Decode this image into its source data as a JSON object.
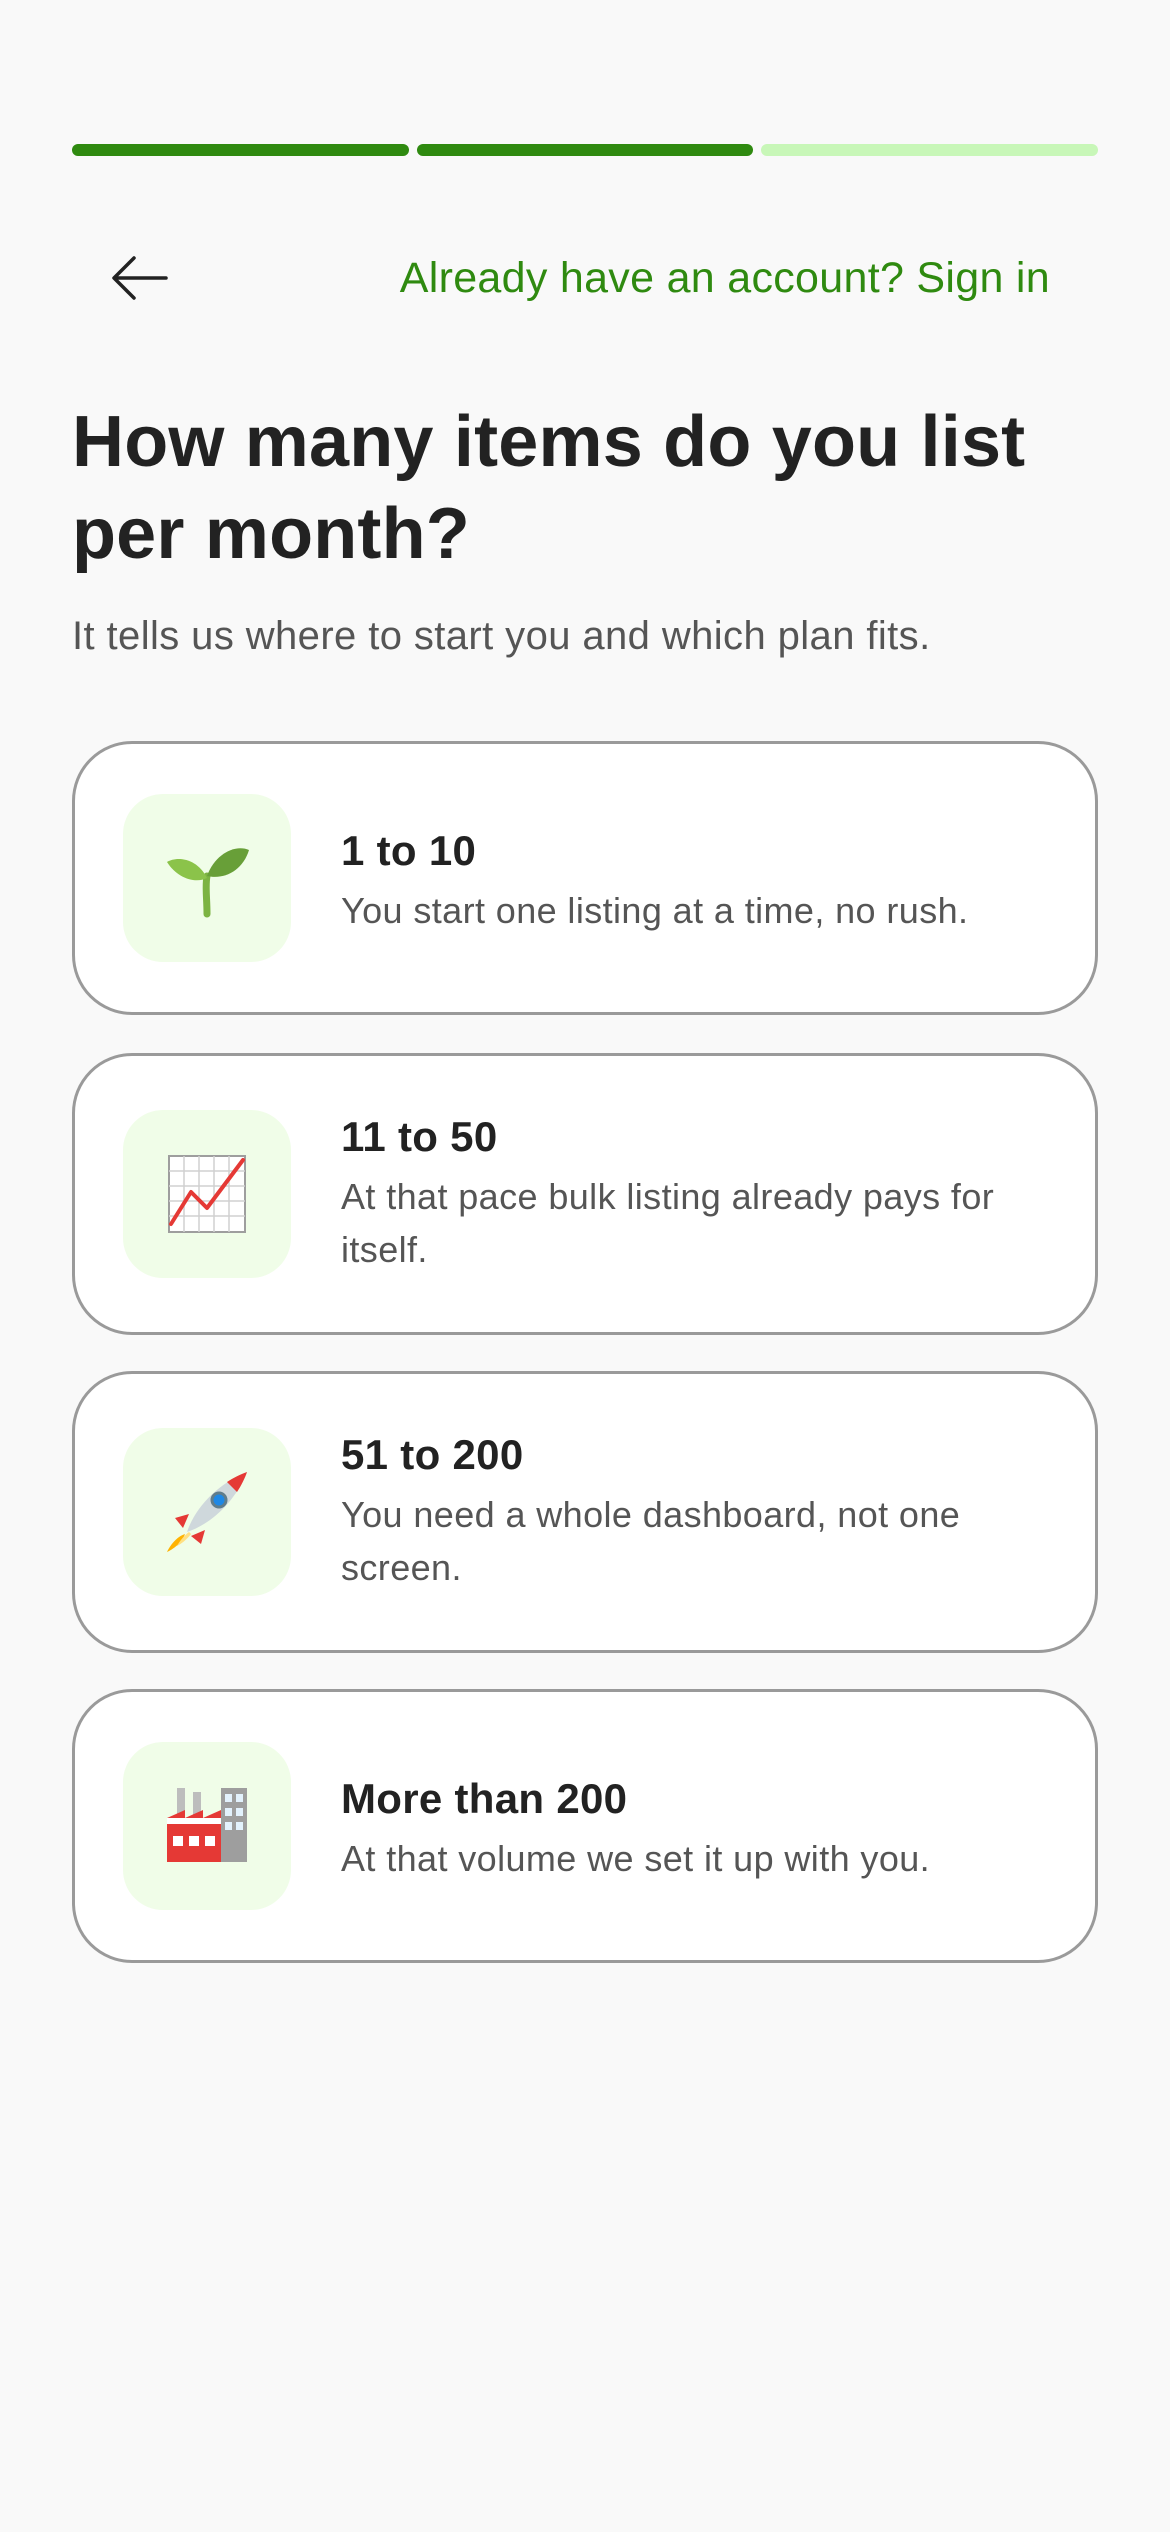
{
  "progress": {
    "steps_total": 3,
    "steps_completed": 2,
    "active_color": "#2f8a10",
    "inactive_color": "#c8f7b8"
  },
  "header": {
    "back_icon": "arrow-left-icon",
    "signin_link": "Already have an account? Sign in"
  },
  "main": {
    "title": "How many items do you list per month?",
    "subtitle": "It tells us where to start you and which plan fits."
  },
  "options": [
    {
      "icon": "seedling-icon",
      "title": "1 to 10",
      "description": "You start one listing at a time, no rush."
    },
    {
      "icon": "chart-increasing-icon",
      "title": "11 to 50",
      "description": "At that pace bulk listing already pays for itself."
    },
    {
      "icon": "rocket-icon",
      "title": "51 to 200",
      "description": "You need a whole dashboard, not one screen."
    },
    {
      "icon": "factory-icon",
      "title": "More than 200",
      "description": "At that volume we set it up with you."
    }
  ],
  "colors": {
    "accent": "#2f8a10",
    "card_border": "#9a9a9a",
    "icon_tile": "#f0fde8",
    "background": "#f9f9f9"
  }
}
